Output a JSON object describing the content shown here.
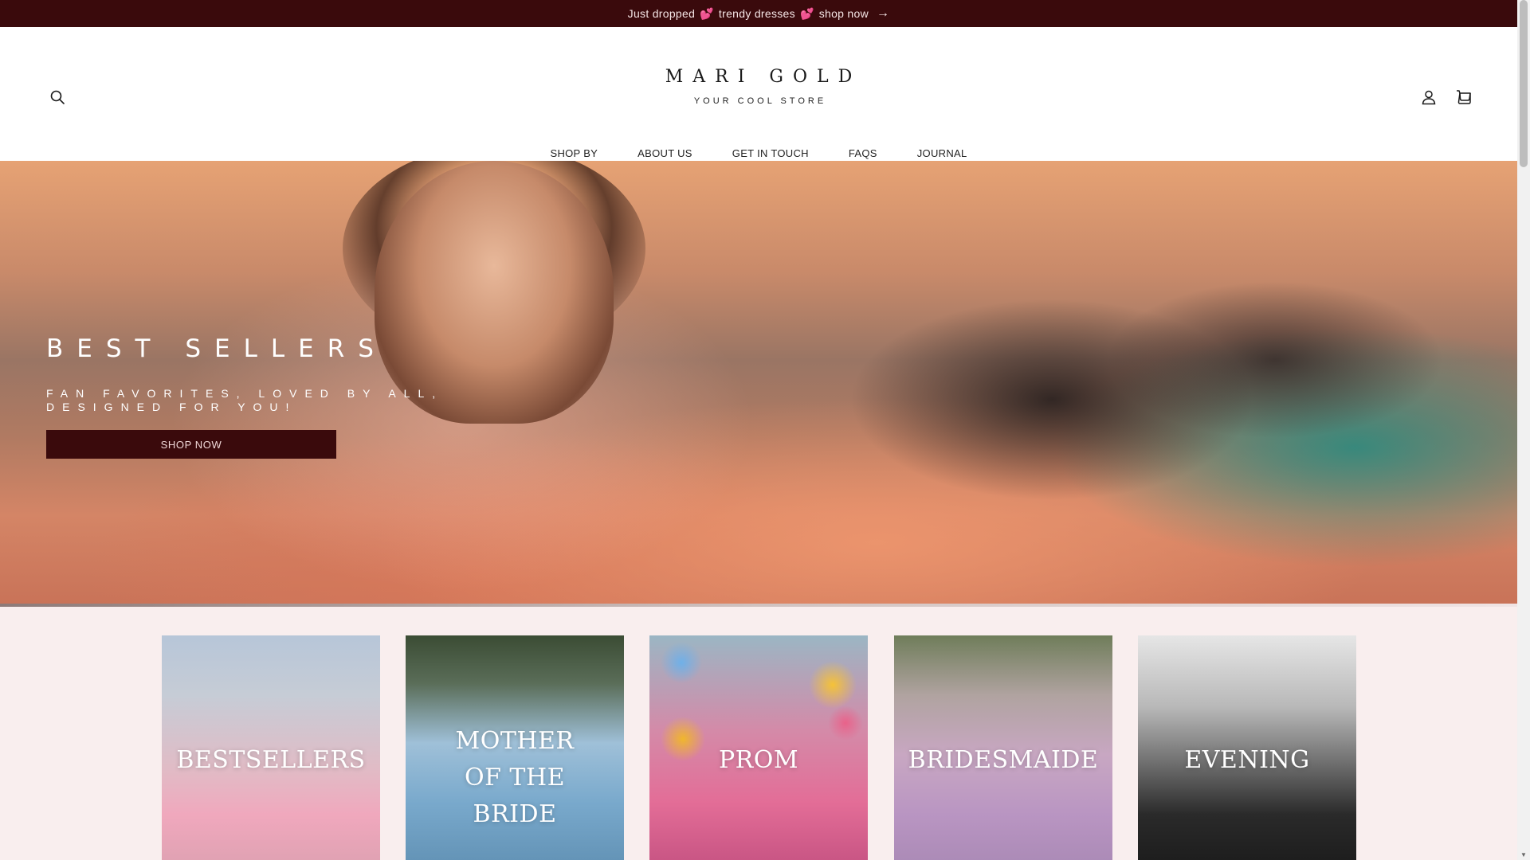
{
  "announcement": {
    "part1": "Just dropped",
    "emoji1": "💕",
    "part2": "trendy dresses",
    "emoji2": "💕",
    "part3": "shop now",
    "arrow": "→"
  },
  "header": {
    "brand": "MARI GOLD",
    "tagline": "YOUR COOL STORE",
    "icons": [
      "search-icon",
      "account-icon",
      "cart-icon"
    ]
  },
  "nav": {
    "items": [
      "SHOP BY",
      "ABOUT US",
      "GET IN TOUCH",
      "FAQS",
      "JOURNAL"
    ]
  },
  "hero": {
    "title": "BEST SELLERS",
    "subtitle": "FAN FAVORITES, LOVED BY ALL, DESIGNED FOR YOU!",
    "button": "SHOP NOW"
  },
  "collections": {
    "items": [
      {
        "label": "BESTSELLERS"
      },
      {
        "label": "MOTHER OF THE BRIDE"
      },
      {
        "label": "PROM"
      },
      {
        "label": "BRIDESMAIDE"
      },
      {
        "label": "EVENING"
      }
    ]
  },
  "colors": {
    "accent": "#3a0a0c",
    "collections_bg": "#f9eeee"
  }
}
